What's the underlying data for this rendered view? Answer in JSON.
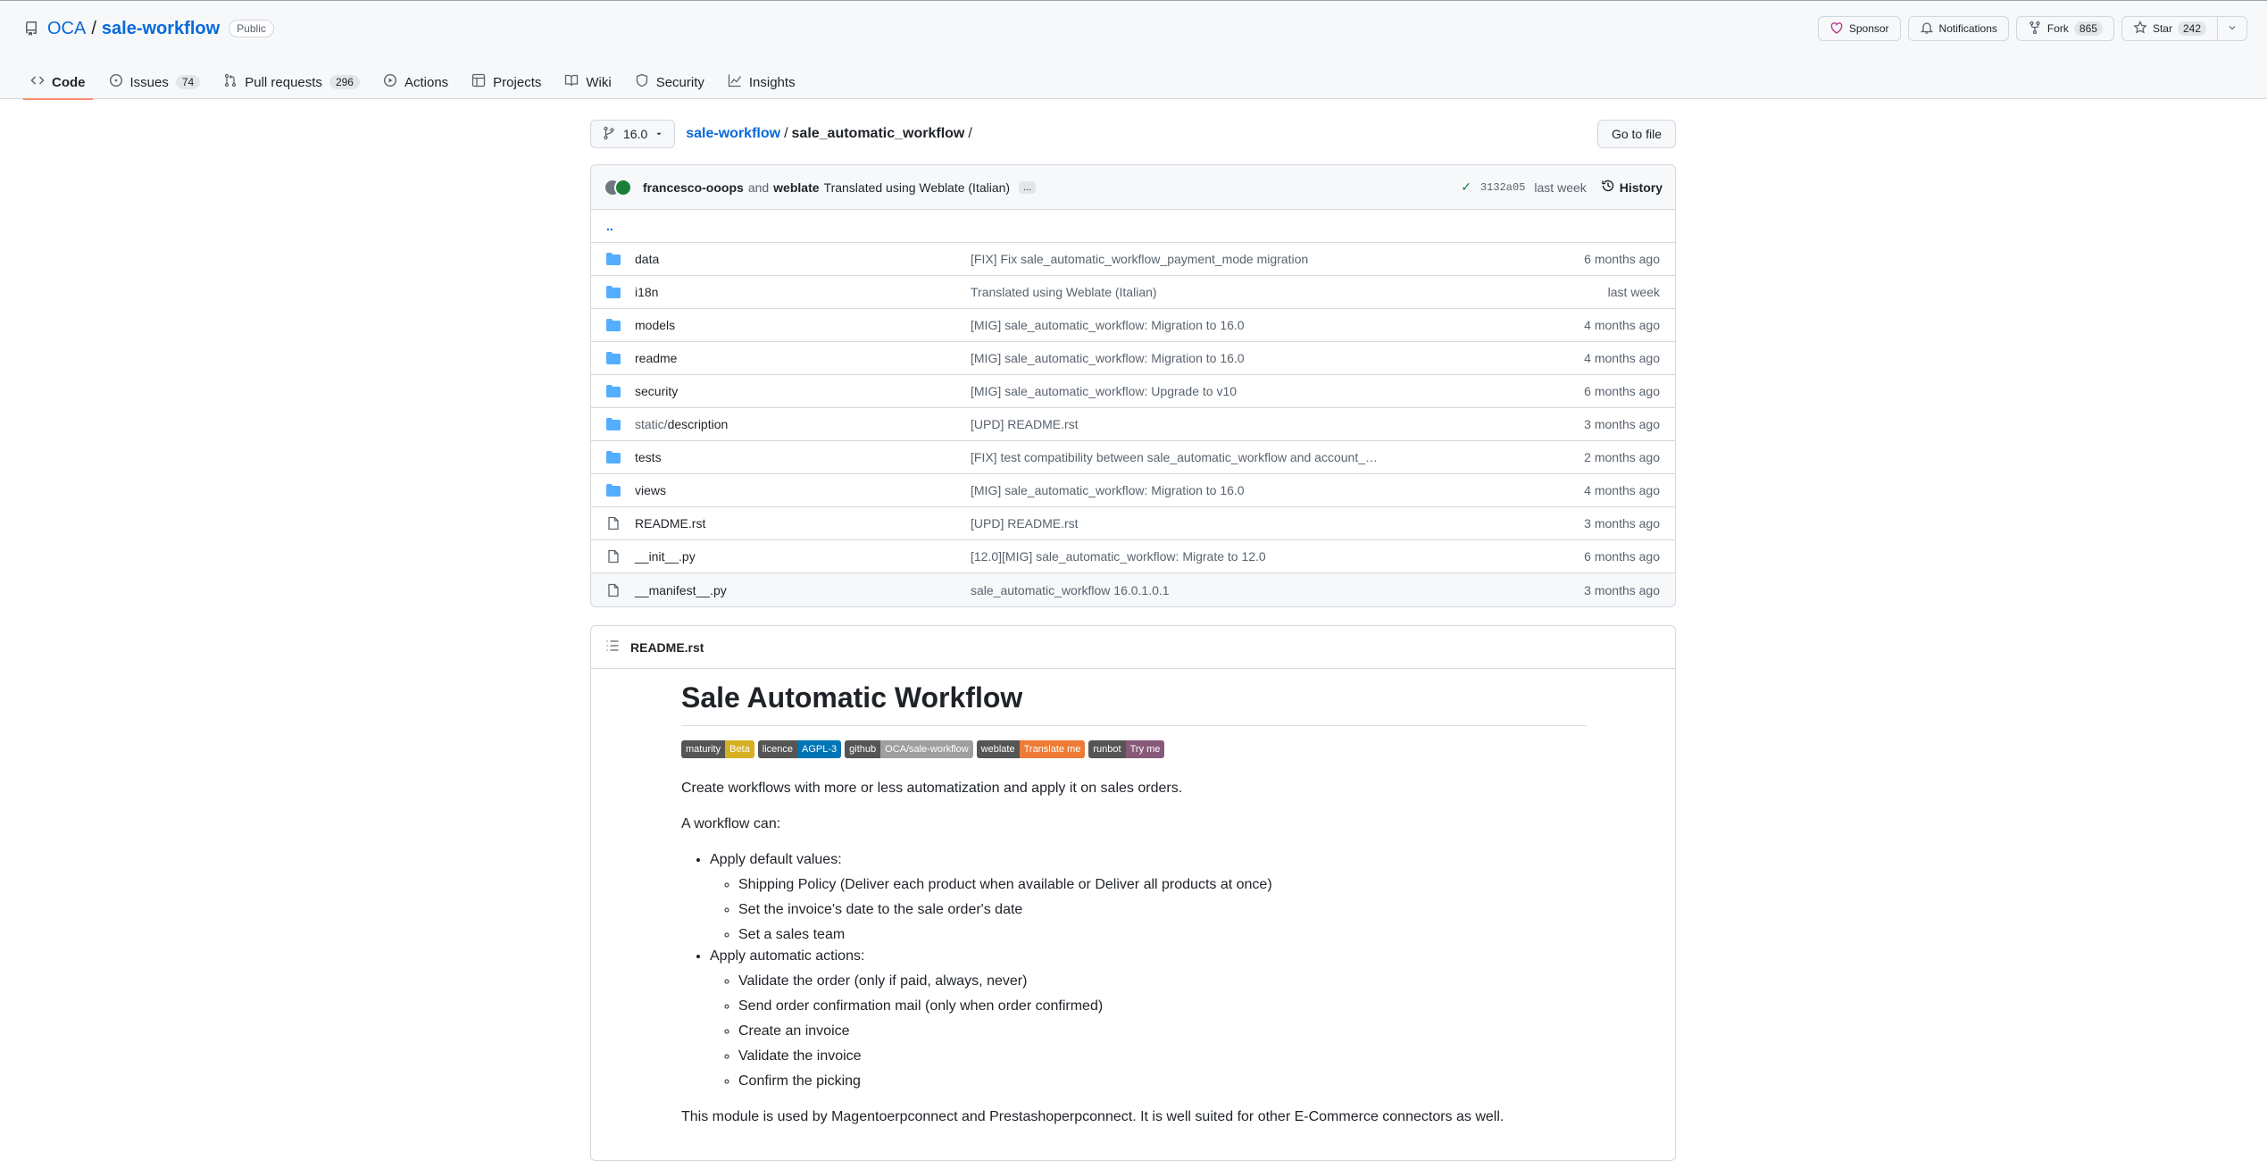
{
  "header": {
    "owner": "OCA",
    "separator": "/",
    "repo": "sale-workflow",
    "visibility": "Public",
    "sponsor_label": "Sponsor",
    "notifications_label": "Notifications",
    "fork_label": "Fork",
    "fork_count": "865",
    "star_label": "Star",
    "star_count": "242"
  },
  "tabs": [
    {
      "label": "Code",
      "count": ""
    },
    {
      "label": "Issues",
      "count": "74"
    },
    {
      "label": "Pull requests",
      "count": "296"
    },
    {
      "label": "Actions",
      "count": ""
    },
    {
      "label": "Projects",
      "count": ""
    },
    {
      "label": "Wiki",
      "count": ""
    },
    {
      "label": "Security",
      "count": ""
    },
    {
      "label": "Insights",
      "count": ""
    }
  ],
  "path": {
    "branch": "16.0",
    "repo_link": "sale-workflow",
    "sep": "/",
    "folder": "sale_automatic_workflow",
    "trail": "/",
    "go_to_file": "Go to file"
  },
  "commit": {
    "author1": "francesco-ooops",
    "and": "and",
    "author2": "weblate",
    "message": "Translated using Weblate (Italian)",
    "ellipsis": "...",
    "sha": "3132a05",
    "when": "last week",
    "history_label": "History"
  },
  "updir": "..",
  "files": [
    {
      "type": "dir",
      "prefix": "",
      "name": "data",
      "message": "[FIX] Fix sale_automatic_workflow_payment_mode migration",
      "age": "6 months ago"
    },
    {
      "type": "dir",
      "prefix": "",
      "name": "i18n",
      "message": "Translated using Weblate (Italian)",
      "age": "last week"
    },
    {
      "type": "dir",
      "prefix": "",
      "name": "models",
      "message": "[MIG] sale_automatic_workflow: Migration to 16.0",
      "age": "4 months ago"
    },
    {
      "type": "dir",
      "prefix": "",
      "name": "readme",
      "message": "[MIG] sale_automatic_workflow: Migration to 16.0",
      "age": "4 months ago"
    },
    {
      "type": "dir",
      "prefix": "",
      "name": "security",
      "message": "[MIG] sale_automatic_workflow: Upgrade to v10",
      "age": "6 months ago"
    },
    {
      "type": "dir",
      "prefix": "static/",
      "name": "description",
      "message": "[UPD] README.rst",
      "age": "3 months ago"
    },
    {
      "type": "dir",
      "prefix": "",
      "name": "tests",
      "message": "[FIX] test compatibility between sale_automatic_workflow and account_…",
      "age": "2 months ago"
    },
    {
      "type": "dir",
      "prefix": "",
      "name": "views",
      "message": "[MIG] sale_automatic_workflow: Migration to 16.0",
      "age": "4 months ago"
    },
    {
      "type": "file",
      "prefix": "",
      "name": "README.rst",
      "message": "[UPD] README.rst",
      "age": "3 months ago"
    },
    {
      "type": "file",
      "prefix": "",
      "name": "__init__.py",
      "message": "[12.0][MIG] sale_automatic_workflow: Migrate to 12.0",
      "age": "6 months ago"
    },
    {
      "type": "file",
      "prefix": "",
      "name": "__manifest__.py",
      "message": "sale_automatic_workflow 16.0.1.0.1",
      "age": "3 months ago"
    }
  ],
  "readme": {
    "filename": "README.rst",
    "title": "Sale Automatic Workflow",
    "badges": [
      {
        "left": "maturity",
        "right": "Beta",
        "color": "#d6af22"
      },
      {
        "left": "licence",
        "right": "AGPL-3",
        "color": "#0075b5"
      },
      {
        "left": "github",
        "right": "OCA/sale-workflow",
        "color": "#9f9f9f"
      },
      {
        "left": "weblate",
        "right": "Translate me",
        "color": "#ee7b35"
      },
      {
        "left": "runbot",
        "right": "Try me",
        "color": "#875a7b"
      }
    ],
    "intro": "Create workflows with more or less automatization and apply it on sales orders.",
    "can": "A workflow can:",
    "defaults_title": "Apply default values:",
    "defaults": [
      "Shipping Policy (Deliver each product when available or Deliver all products at once)",
      "Set the invoice's date to the sale order's date",
      "Set a sales team"
    ],
    "actions_title": "Apply automatic actions:",
    "actions": [
      "Validate the order (only if paid, always, never)",
      "Send order confirmation mail (only when order confirmed)",
      "Create an invoice",
      "Validate the invoice",
      "Confirm the picking"
    ],
    "footer": "This module is used by Magentoerpconnect and Prestashoperpconnect. It is well suited for other E-Commerce connectors as well."
  }
}
